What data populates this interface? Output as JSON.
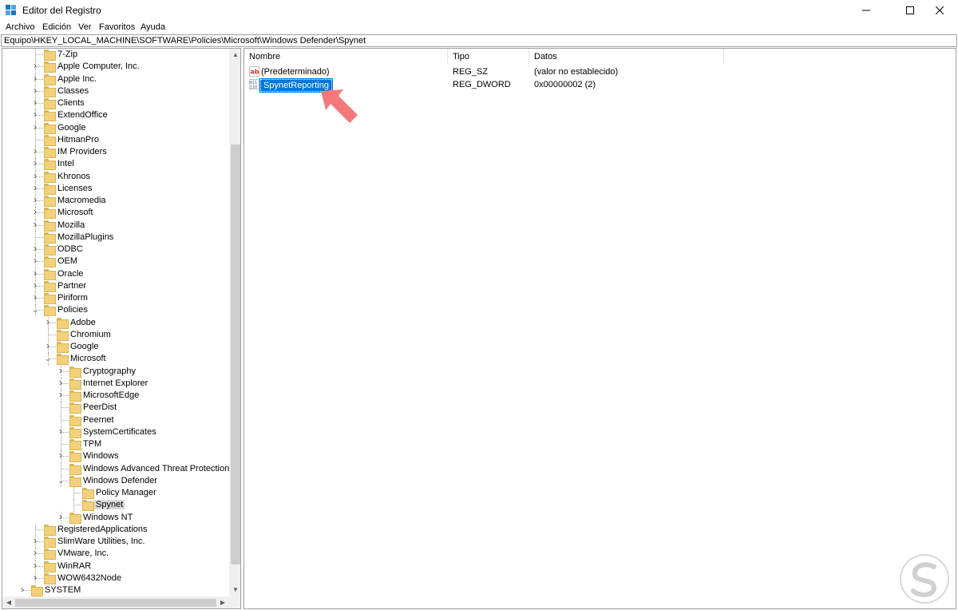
{
  "window": {
    "title": "Editor del Registro",
    "icons": {
      "app": "registry-editor-icon",
      "minimize": "minimize-icon",
      "maximize": "maximize-icon",
      "close": "close-icon"
    }
  },
  "menu": [
    "Archivo",
    "Edición",
    "Ver",
    "Favoritos",
    "Ayuda"
  ],
  "address": "Equipo\\HKEY_LOCAL_MACHINE\\SOFTWARE\\Policies\\Microsoft\\Windows Defender\\Spynet",
  "tree": [
    {
      "label": "7-Zip",
      "level": 0,
      "expander": "none"
    },
    {
      "label": "Apple Computer, Inc.",
      "level": 0,
      "expander": "collapsed"
    },
    {
      "label": "Apple Inc.",
      "level": 0,
      "expander": "collapsed"
    },
    {
      "label": "Classes",
      "level": 0,
      "expander": "collapsed"
    },
    {
      "label": "Clients",
      "level": 0,
      "expander": "collapsed"
    },
    {
      "label": "ExtendOffice",
      "level": 0,
      "expander": "collapsed"
    },
    {
      "label": "Google",
      "level": 0,
      "expander": "collapsed"
    },
    {
      "label": "HitmanPro",
      "level": 0,
      "expander": "none"
    },
    {
      "label": "IM Providers",
      "level": 0,
      "expander": "collapsed"
    },
    {
      "label": "Intel",
      "level": 0,
      "expander": "collapsed"
    },
    {
      "label": "Khronos",
      "level": 0,
      "expander": "collapsed"
    },
    {
      "label": "Licenses",
      "level": 0,
      "expander": "collapsed"
    },
    {
      "label": "Macromedia",
      "level": 0,
      "expander": "collapsed"
    },
    {
      "label": "Microsoft",
      "level": 0,
      "expander": "collapsed"
    },
    {
      "label": "Mozilla",
      "level": 0,
      "expander": "collapsed"
    },
    {
      "label": "MozillaPlugins",
      "level": 0,
      "expander": "none"
    },
    {
      "label": "ODBC",
      "level": 0,
      "expander": "collapsed"
    },
    {
      "label": "OEM",
      "level": 0,
      "expander": "collapsed"
    },
    {
      "label": "Oracle",
      "level": 0,
      "expander": "collapsed"
    },
    {
      "label": "Partner",
      "level": 0,
      "expander": "collapsed"
    },
    {
      "label": "Piriform",
      "level": 0,
      "expander": "collapsed"
    },
    {
      "label": "Policies",
      "level": 0,
      "expander": "expanded"
    },
    {
      "label": "Adobe",
      "level": 1,
      "expander": "collapsed"
    },
    {
      "label": "Chromium",
      "level": 1,
      "expander": "none"
    },
    {
      "label": "Google",
      "level": 1,
      "expander": "collapsed"
    },
    {
      "label": "Microsoft",
      "level": 1,
      "expander": "expanded"
    },
    {
      "label": "Cryptography",
      "level": 2,
      "expander": "collapsed"
    },
    {
      "label": "Internet Explorer",
      "level": 2,
      "expander": "collapsed"
    },
    {
      "label": "MicrosoftEdge",
      "level": 2,
      "expander": "collapsed"
    },
    {
      "label": "PeerDist",
      "level": 2,
      "expander": "none"
    },
    {
      "label": "Peernet",
      "level": 2,
      "expander": "none"
    },
    {
      "label": "SystemCertificates",
      "level": 2,
      "expander": "collapsed"
    },
    {
      "label": "TPM",
      "level": 2,
      "expander": "none"
    },
    {
      "label": "Windows",
      "level": 2,
      "expander": "collapsed"
    },
    {
      "label": "Windows Advanced Threat Protection",
      "level": 2,
      "expander": "none"
    },
    {
      "label": "Windows Defender",
      "level": 2,
      "expander": "expanded"
    },
    {
      "label": "Policy Manager",
      "level": 3,
      "expander": "none"
    },
    {
      "label": "Spynet",
      "level": 3,
      "expander": "none",
      "selected": true
    },
    {
      "label": "Windows NT",
      "level": 2,
      "expander": "collapsed"
    },
    {
      "label": "RegisteredApplications",
      "level": 0,
      "expander": "none"
    },
    {
      "label": "SlimWare Utilities, Inc.",
      "level": 0,
      "expander": "collapsed"
    },
    {
      "label": "VMware, Inc.",
      "level": 0,
      "expander": "collapsed"
    },
    {
      "label": "WinRAR",
      "level": 0,
      "expander": "collapsed"
    },
    {
      "label": "WOW6432Node",
      "level": 0,
      "expander": "collapsed"
    },
    {
      "label": "SYSTEM",
      "level": -1,
      "expander": "collapsed"
    }
  ],
  "list": {
    "columns": [
      "Nombre",
      "Tipo",
      "Datos"
    ],
    "rows": [
      {
        "name": "(Predeterminado)",
        "type": "REG_SZ",
        "data": "(valor no establecido)",
        "icon": "string-value-icon"
      },
      {
        "name": "SpynetReporting",
        "type": "REG_DWORD",
        "data": "0x00000002 (2)",
        "icon": "dword-value-icon",
        "selected": true
      }
    ]
  },
  "colors": {
    "selection": "#0078d7",
    "folder": "#f2d17a",
    "arrow": "#f47a7a",
    "tree_selection": "#d9d9d9"
  }
}
